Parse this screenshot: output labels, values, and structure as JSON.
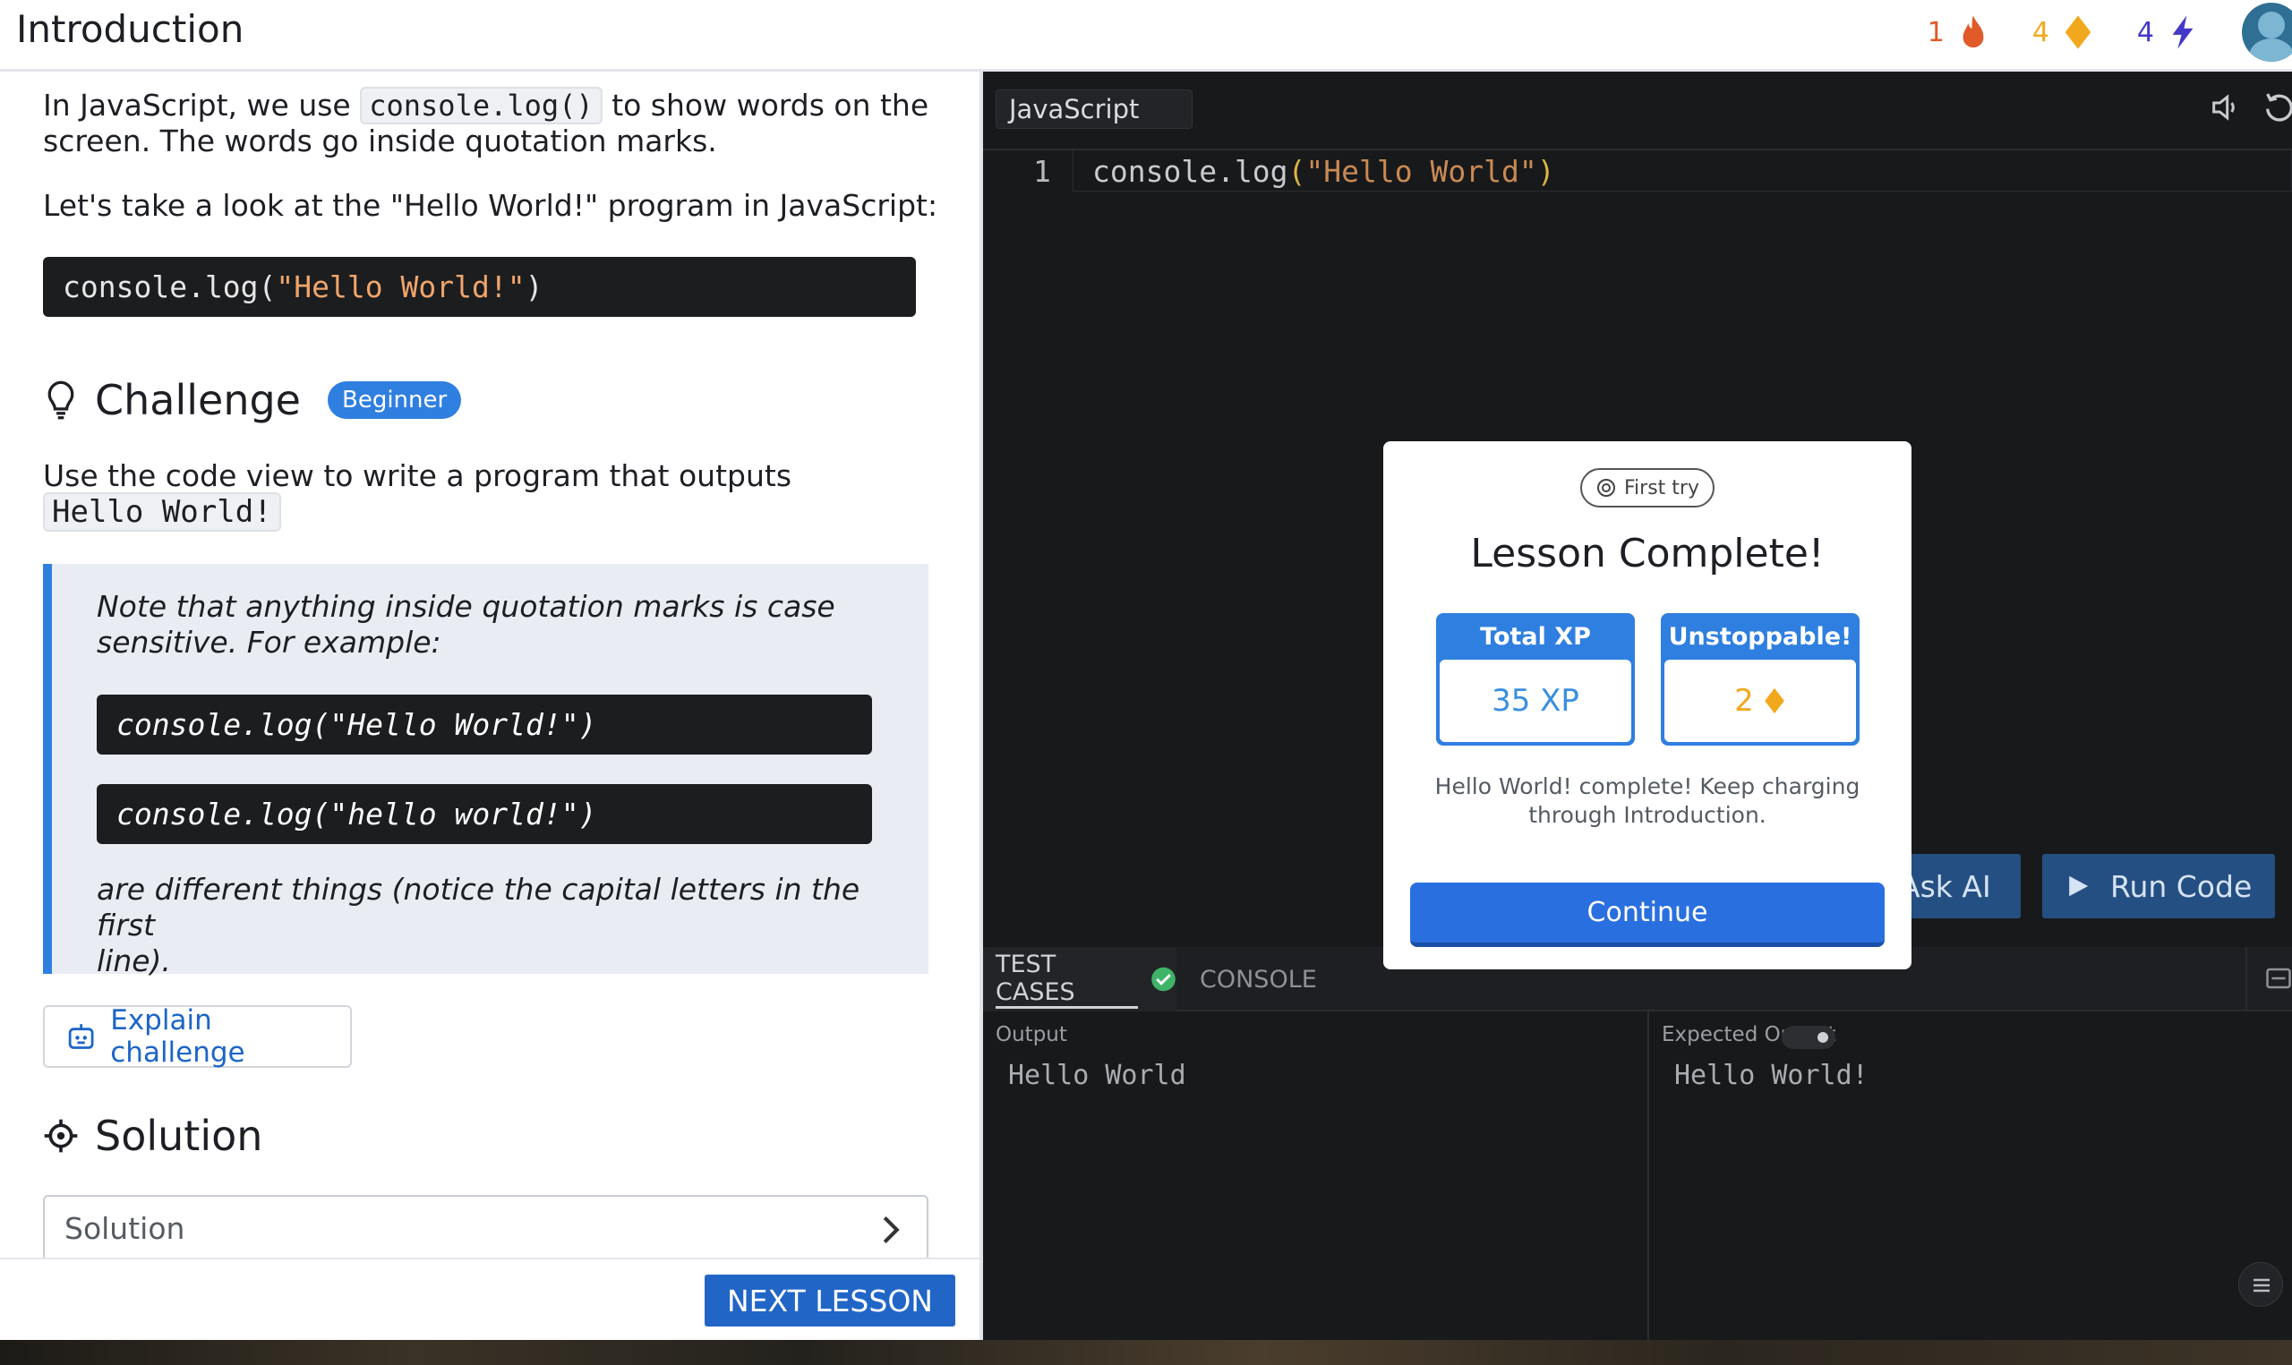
{
  "header": {
    "title": "Introduction",
    "stats": [
      {
        "value": "1",
        "icon": "flame-icon",
        "color": "#e05a2a"
      },
      {
        "value": "4",
        "icon": "gem-icon",
        "color": "#f2a81d"
      },
      {
        "value": "4",
        "icon": "lightning-icon",
        "color": "#4338ca"
      }
    ]
  },
  "lesson": {
    "intro_before": "In JavaScript, we use",
    "intro_code": "console.log()",
    "intro_after": "to show words on the",
    "intro_line2": "screen. The words go inside quotation marks.",
    "lookat": "Let's take a look at the \"Hello World!\" program in JavaScript:",
    "example_prefix": "console.log(",
    "example_string": "\"Hello World!\"",
    "example_suffix": ")",
    "challenge_title": "Challenge",
    "challenge_badge": "Beginner",
    "challenge_text": "Use the code view to write a program that outputs",
    "challenge_code": "Hello World!",
    "note_line1": "Note that anything inside quotation marks is case",
    "note_line2": "sensitive. For example:",
    "note_code1": "console.log(\"Hello World!\")",
    "note_code2": "console.log(\"hello world!\")",
    "note_after1": "are different things (notice the capital letters in the first",
    "note_after2": "line).",
    "explain_label": "Explain challenge",
    "solution_title": "Solution",
    "solution_box": "Solution",
    "next_label": "NEXT LESSON"
  },
  "editor": {
    "language": "JavaScript",
    "line_number": "1",
    "code_prefix": "console.log",
    "code_open": "(",
    "code_string": "\"Hello World\"",
    "code_close": ")",
    "ask_ai_label": "Ask AI",
    "run_label": "Run Code",
    "tabs": {
      "test_cases": "TEST CASES",
      "console": "CONSOLE"
    },
    "output_label": "Output",
    "output_value": "Hello World",
    "expected_label": "Expected Output",
    "expected_value": "Hello World!"
  },
  "modal": {
    "badge": "First try",
    "title": "Lesson Complete!",
    "xp_title": "Total XP",
    "xp_value": "35 XP",
    "streak_title": "Unstoppable!",
    "streak_value": "2",
    "description": "Hello World! complete! Keep charging through Introduction.",
    "continue_label": "Continue"
  },
  "colors": {
    "accent": "#2f7fe0",
    "editor_bg": "#18191b",
    "success": "#3fb468",
    "gem": "#f2a81d"
  }
}
